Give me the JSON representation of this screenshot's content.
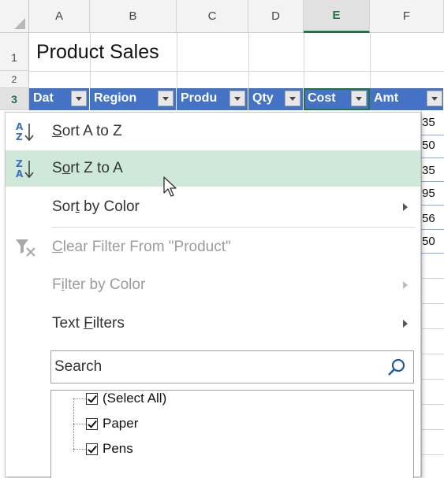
{
  "columns": [
    "A",
    "B",
    "C",
    "D",
    "E",
    "F"
  ],
  "selected_column": "E",
  "rows": [
    "1",
    "2",
    "3"
  ],
  "title": "Product Sales",
  "headers": [
    {
      "label": "Dat"
    },
    {
      "label": "Region"
    },
    {
      "label": "Produ"
    },
    {
      "label": "Qty"
    },
    {
      "label": "Cost"
    },
    {
      "label": "Amt"
    }
  ],
  "amt_values": [
    "35",
    "50",
    "35",
    "95",
    "56",
    "50"
  ],
  "menu": {
    "sort_az": {
      "pre": "",
      "u": "S",
      "post": "ort A to Z"
    },
    "sort_za": {
      "pre": "S",
      "u": "o",
      "post": "rt Z to A"
    },
    "sort_color": {
      "pre": "Sor",
      "u": "t",
      "post": " by Color"
    },
    "clear_filter": {
      "pre": "",
      "u": "C",
      "post": "lear Filter From \"Product\""
    },
    "filter_color": {
      "pre": "F",
      "u": "i",
      "post": "lter by Color"
    },
    "text_filters": {
      "pre": "Text ",
      "u": "F",
      "post": "ilters"
    }
  },
  "search": {
    "placeholder": "Search"
  },
  "list": [
    {
      "label": "(Select All)",
      "checked": true
    },
    {
      "label": "Paper",
      "checked": true
    },
    {
      "label": "Pens",
      "checked": true
    }
  ],
  "colors": {
    "header_fill": "#4472c4",
    "hover": "#cfe8d9",
    "accent": "#217346",
    "search_icon": "#1e5aa0"
  }
}
